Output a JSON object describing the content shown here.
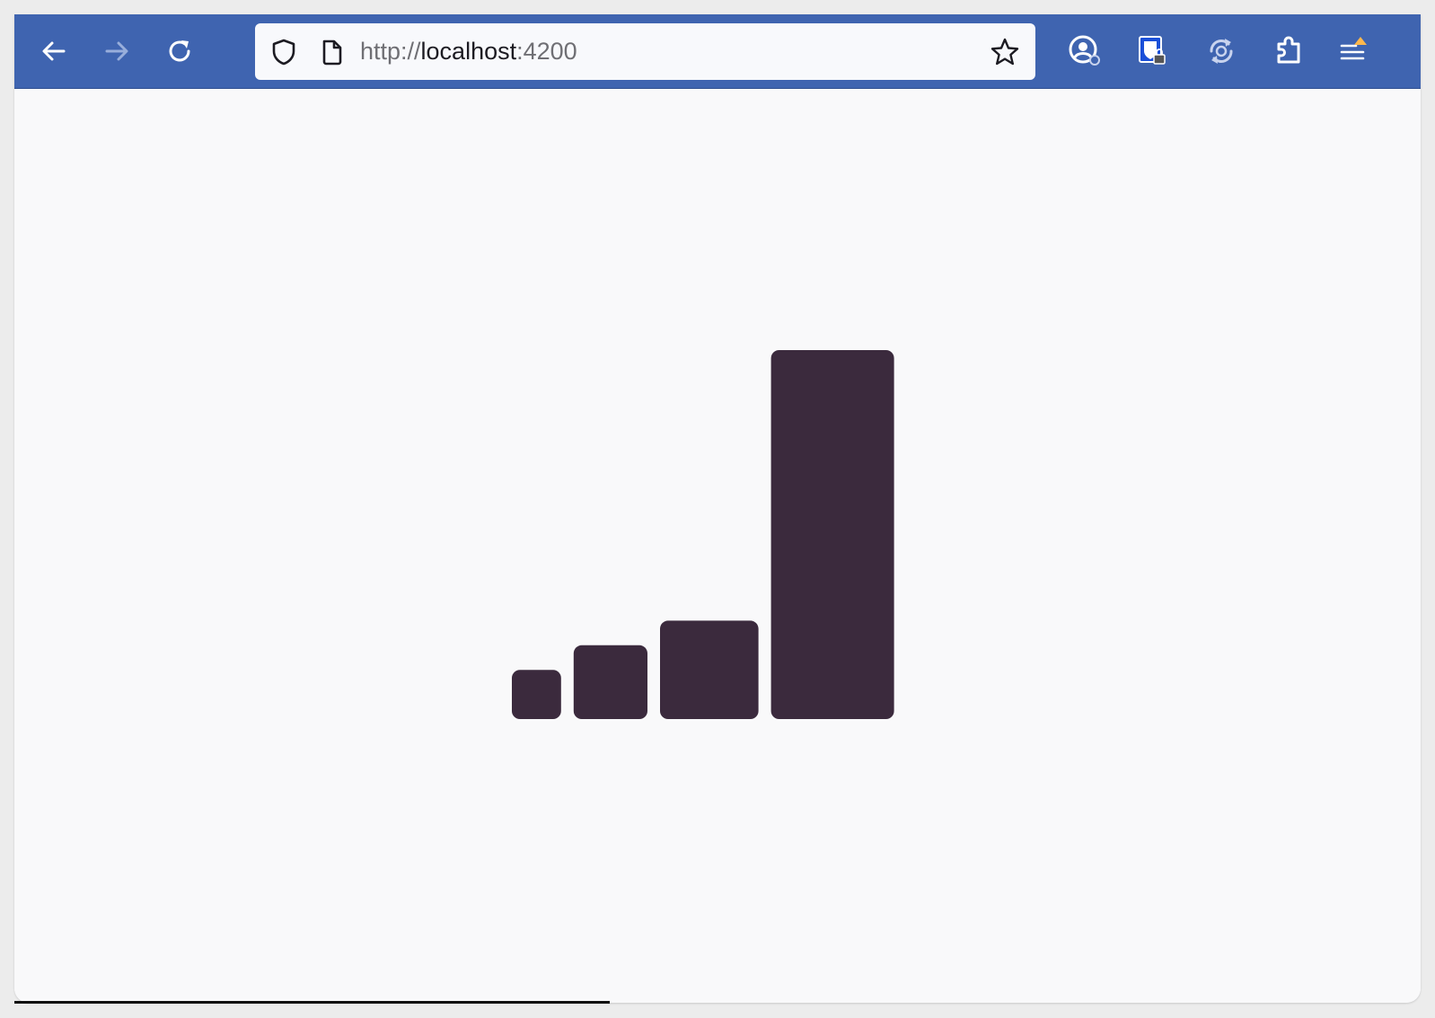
{
  "browser": {
    "url_scheme": "http://",
    "url_host": "localhost",
    "url_port": ":4200",
    "toolbar_color": "#3f64b0",
    "icons": {
      "back": "arrow-left-icon",
      "forward": "arrow-right-icon",
      "reload": "reload-icon",
      "shield": "shield-icon",
      "page": "page-icon",
      "bookmark": "star-icon",
      "account": "account-icon",
      "password_manager": "password-manager-icon",
      "sync": "sync-icon",
      "extensions": "puzzle-icon",
      "menu": "hamburger-menu-icon"
    },
    "menu_alert_color": "#ffb84d"
  },
  "chart_data": {
    "type": "bar",
    "values": [
      1,
      1.5,
      2,
      7.5
    ],
    "bar_color": "#3b2a3d"
  }
}
